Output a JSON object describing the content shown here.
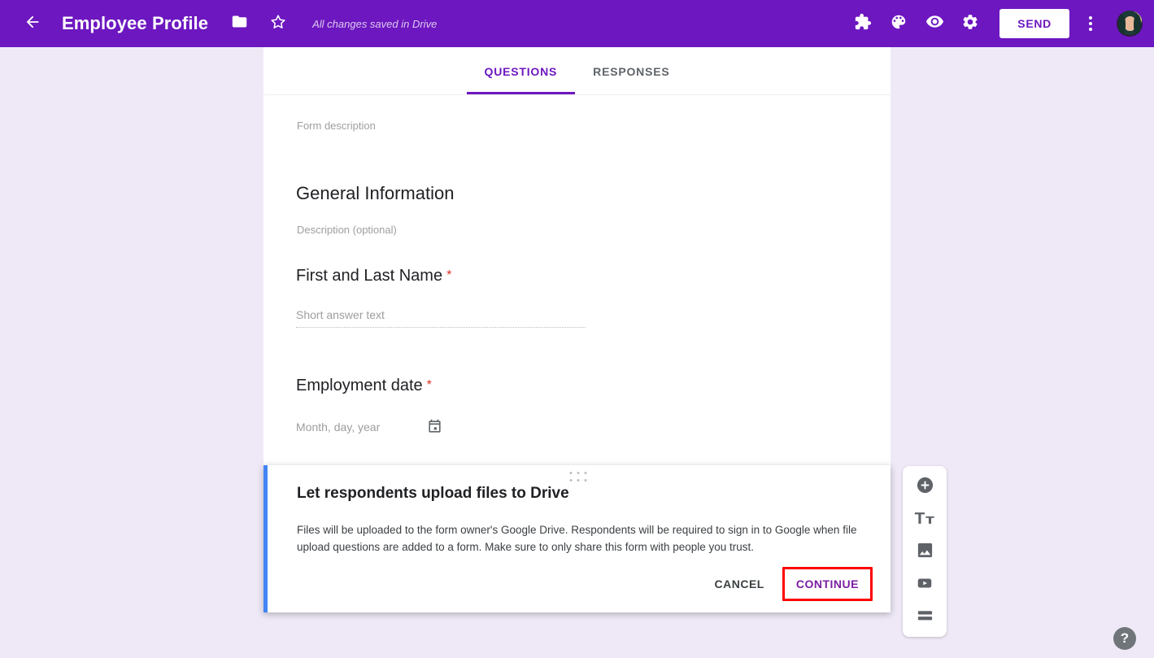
{
  "appbar": {
    "back_icon": "arrow-back-icon",
    "title": "Employee Profile",
    "folder_icon": "folder-icon",
    "star_icon": "star-icon",
    "save_status": "All changes saved in Drive",
    "addons_icon": "puzzle-piece-icon",
    "theme_icon": "palette-icon",
    "preview_icon": "eye-icon",
    "settings_icon": "gear-icon",
    "send_label": "SEND",
    "more_icon": "more-vert-icon",
    "avatar_name": "user-avatar",
    "brand_color": "#6D17C0"
  },
  "tabs": [
    {
      "label": "QUESTIONS",
      "active": true
    },
    {
      "label": "RESPONSES",
      "active": false
    }
  ],
  "form": {
    "description_placeholder": "Form description",
    "section_title": "General Information",
    "section_description_placeholder": "Description (optional)",
    "required_marker": "*",
    "questions": [
      {
        "label": "First and Last Name",
        "required": true,
        "answer_placeholder": "Short answer text",
        "type": "short-answer"
      },
      {
        "label": "Employment date",
        "required": true,
        "answer_placeholder": "Month, day, year",
        "type": "date",
        "icon": "calendar-icon"
      }
    ]
  },
  "side_toolbar": {
    "items": [
      {
        "icon": "add-question-icon",
        "name": "add-question"
      },
      {
        "icon": "title-text-icon",
        "name": "add-title-and-description"
      },
      {
        "icon": "image-icon",
        "name": "add-image"
      },
      {
        "icon": "video-icon",
        "name": "add-video"
      },
      {
        "icon": "section-icon",
        "name": "add-section"
      }
    ]
  },
  "dialog": {
    "title": "Let respondents upload files to Drive",
    "body": "Files will be uploaded to the form owner's Google Drive. Respondents will be required to sign in to Google when file upload questions are added to a form. Make sure to only share this form with people you trust.",
    "cancel_label": "CANCEL",
    "continue_label": "CONTINUE",
    "accent_border_color": "#4285F4",
    "highlight_color": "#FF0000",
    "drag_handle_icon": "drag-handle-icon"
  },
  "help": {
    "label": "?",
    "icon": "help-icon"
  }
}
